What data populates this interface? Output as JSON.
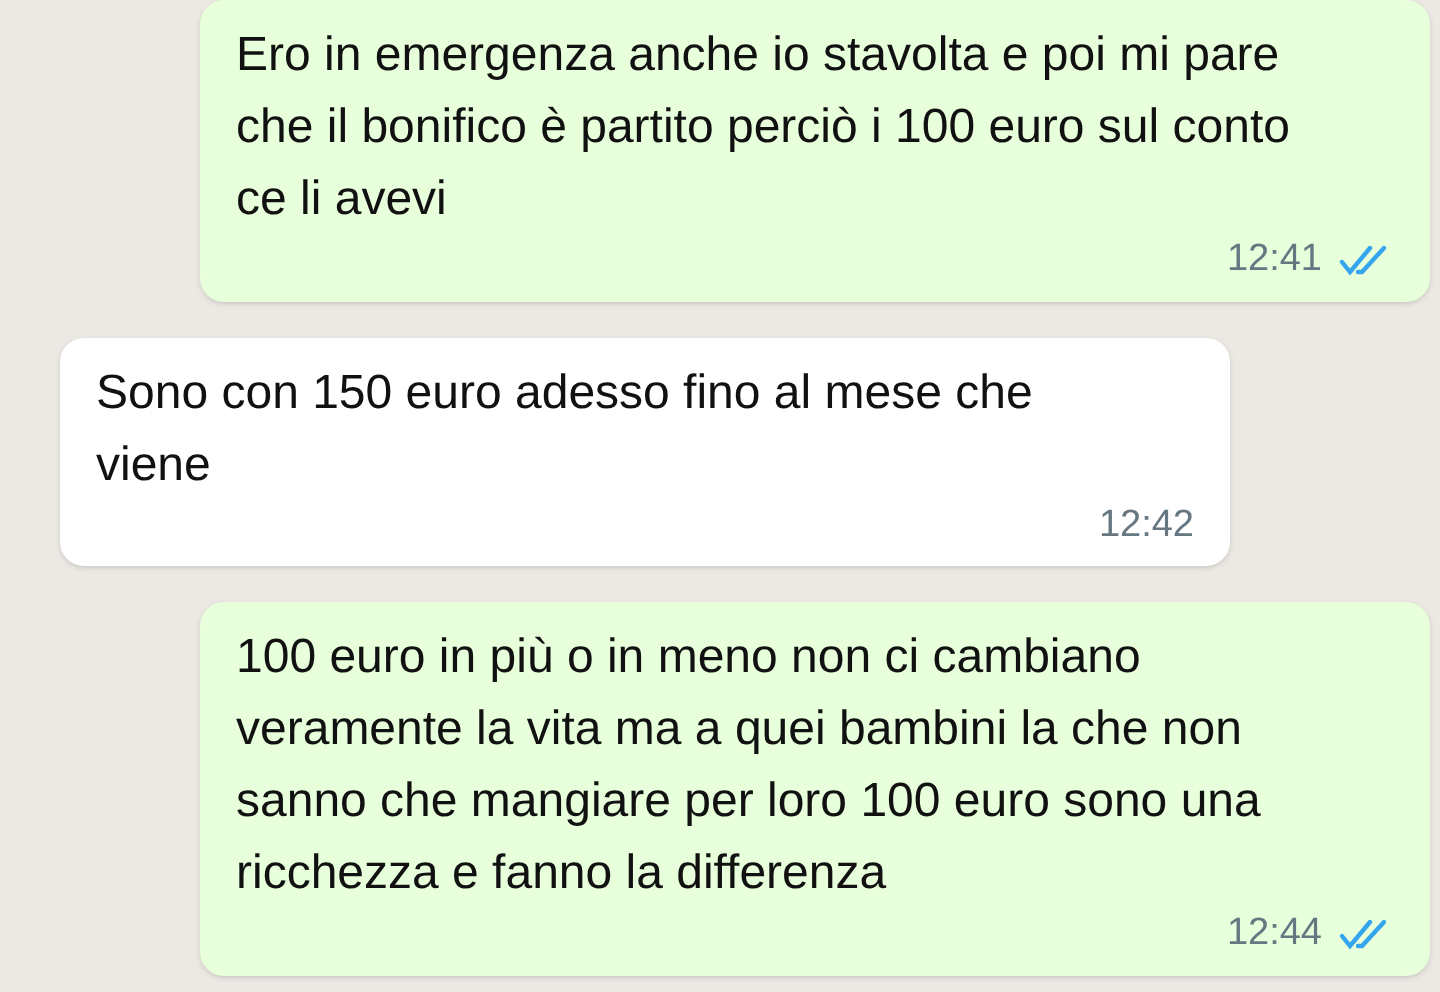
{
  "messages": [
    {
      "kind": "outgoing",
      "text": "Ero in emergenza anche io stavolta e poi mi pare che il bonifico è partito perciò i 100 euro sul conto ce li avevi",
      "time": "12:41",
      "read": true
    },
    {
      "kind": "incoming",
      "text": "Sono con 150 euro adesso fino al mese che viene",
      "time": "12:42"
    },
    {
      "kind": "outgoing",
      "text": "100 euro in più o in meno non ci cambiano veramente la vita ma a quei bambini la che non sanno che mangiare per loro 100 euro sono una ricchezza e fanno la differenza",
      "time": "12:44",
      "read": true
    }
  ]
}
